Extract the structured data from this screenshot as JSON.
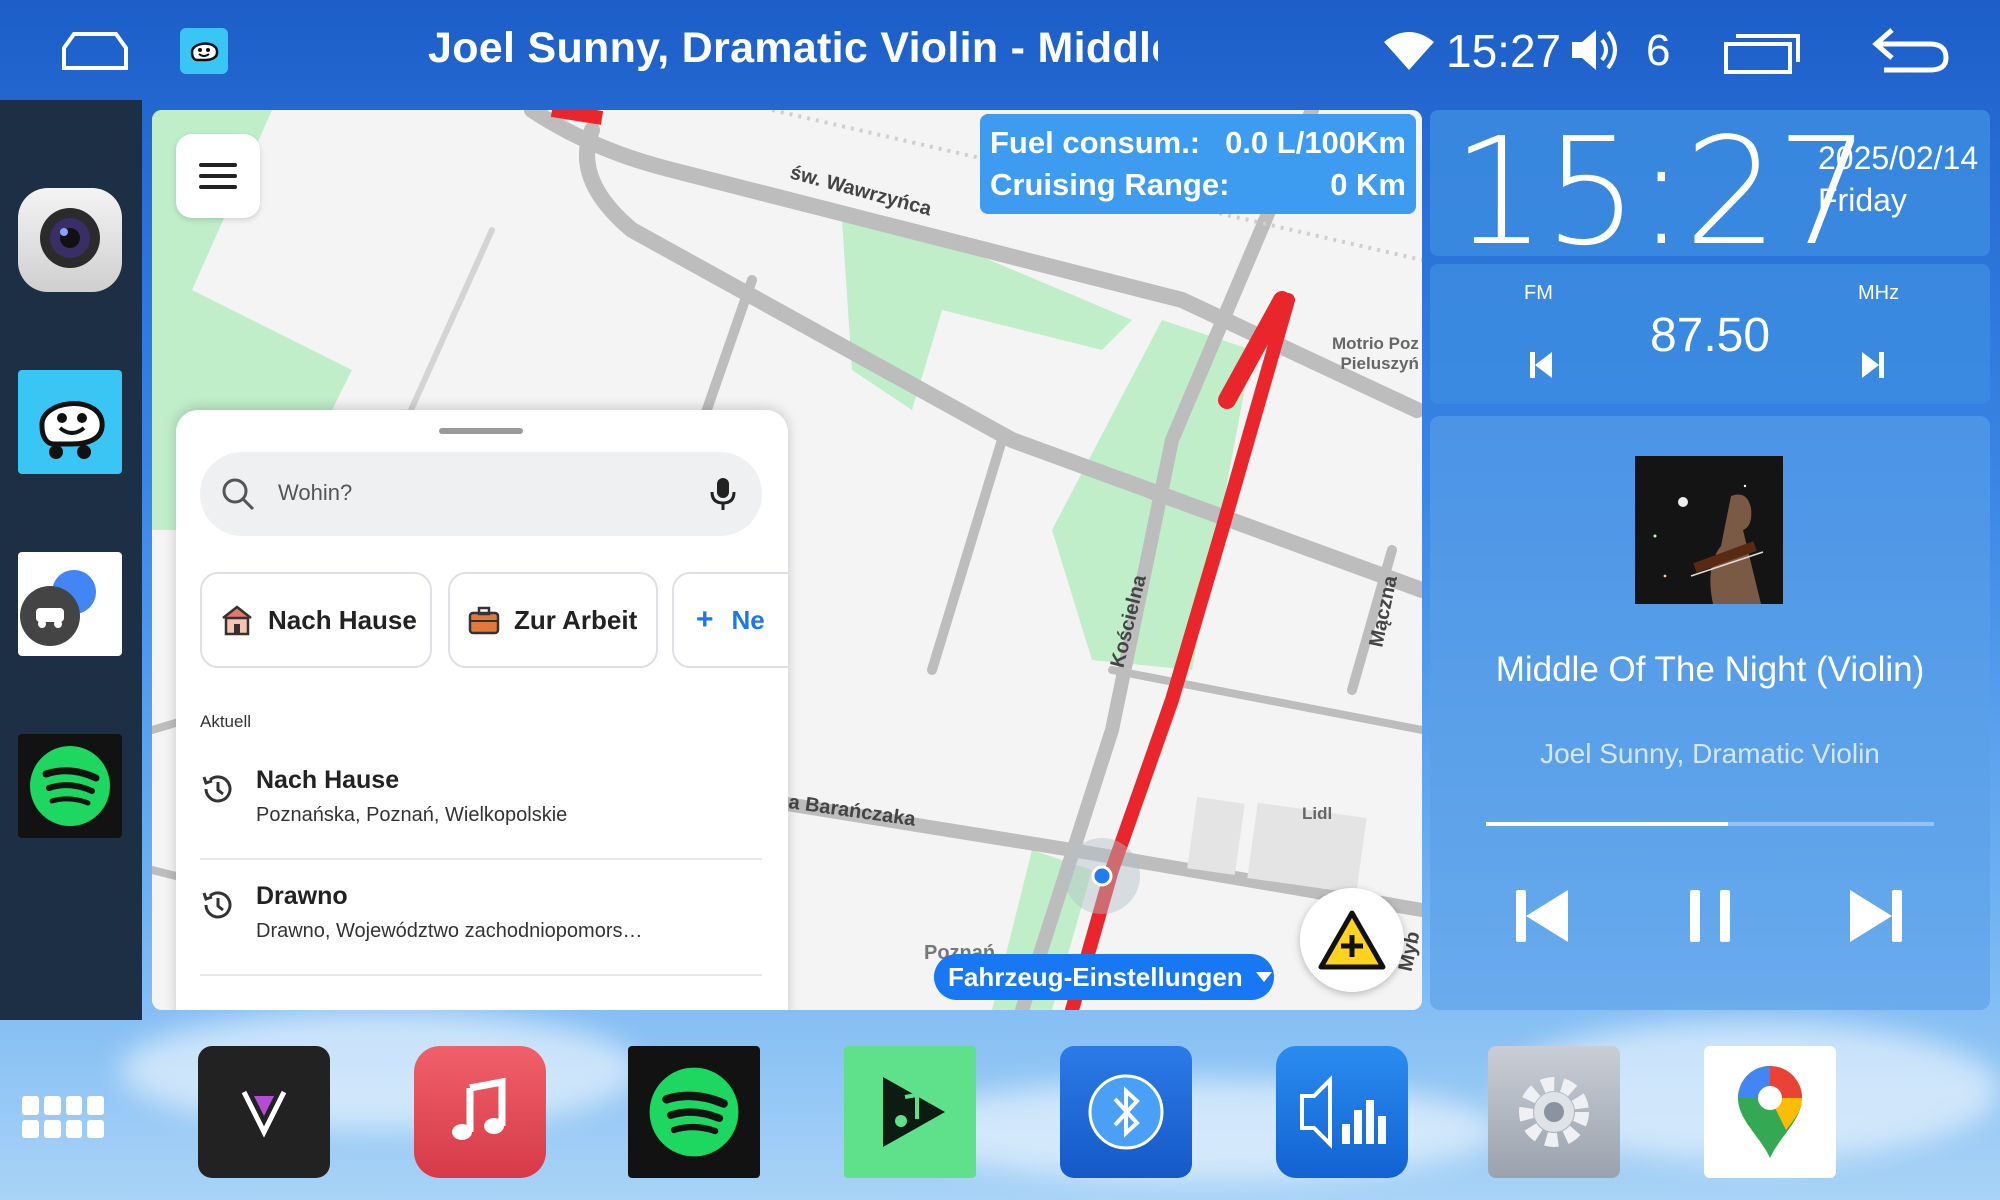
{
  "status_bar": {
    "title": "Joel Sunny, Dramatic Violin - Middle C",
    "time": "15:27",
    "volume": "6",
    "icons": [
      "home-icon",
      "waze-icon",
      "wifi-icon",
      "volume-icon",
      "recent-apps-icon",
      "back-icon"
    ]
  },
  "left_dock": {
    "apps": [
      "camera-app",
      "waze-app",
      "car-app",
      "spotify-app"
    ]
  },
  "map": {
    "fuel": {
      "consumption_label": "Fuel consum.:",
      "consumption_value": "0.0 L/100Km",
      "range_label": "Cruising Range:",
      "range_value": "0 Km"
    },
    "streets": {
      "s1": "św. Wawrzyńca",
      "s2": "Kościelna",
      "s3": "Mączna",
      "s4": "a Barańczaka",
      "s5": "Poznań",
      "s6": "Myb"
    },
    "pois": {
      "motrio1": "Motrio Poz",
      "motrio2": "Pieluszyń",
      "lidl": "Lidl"
    },
    "vehicle_settings": "Fahrzeug-Einstellungen",
    "route_color": "#e8262b"
  },
  "search_sheet": {
    "placeholder": "Wohin?",
    "chips": [
      "Nach Hause",
      "Zur Arbeit",
      "Ne"
    ],
    "section_label": "Aktuell",
    "recents": [
      {
        "title": "Nach Hause",
        "subtitle": "Poznańska, Poznań, Wielkopolskie"
      },
      {
        "title": "Drawno",
        "subtitle": "Drawno, Województwo zachodniopomors…"
      }
    ]
  },
  "clock_widget": {
    "time": "15:27",
    "date": "2025/02/14",
    "day": "Friday"
  },
  "radio_widget": {
    "band": "FM",
    "unit": "MHz",
    "frequency": "87.50"
  },
  "player": {
    "title": "Middle Of The Night (Violin)",
    "artist": "Joel Sunny, Dramatic Violin",
    "progress": 0.54
  },
  "bottom_dock": {
    "apps": [
      "app-drawer",
      "vlc-style-app",
      "music-app",
      "spotify-app",
      "play-music-app",
      "bluetooth-app",
      "equalizer-app",
      "settings-app",
      "google-maps-app"
    ]
  },
  "colors": {
    "accent": "#3d9cf0",
    "spotify": "#1ed760",
    "waze": "#39c6f4"
  }
}
